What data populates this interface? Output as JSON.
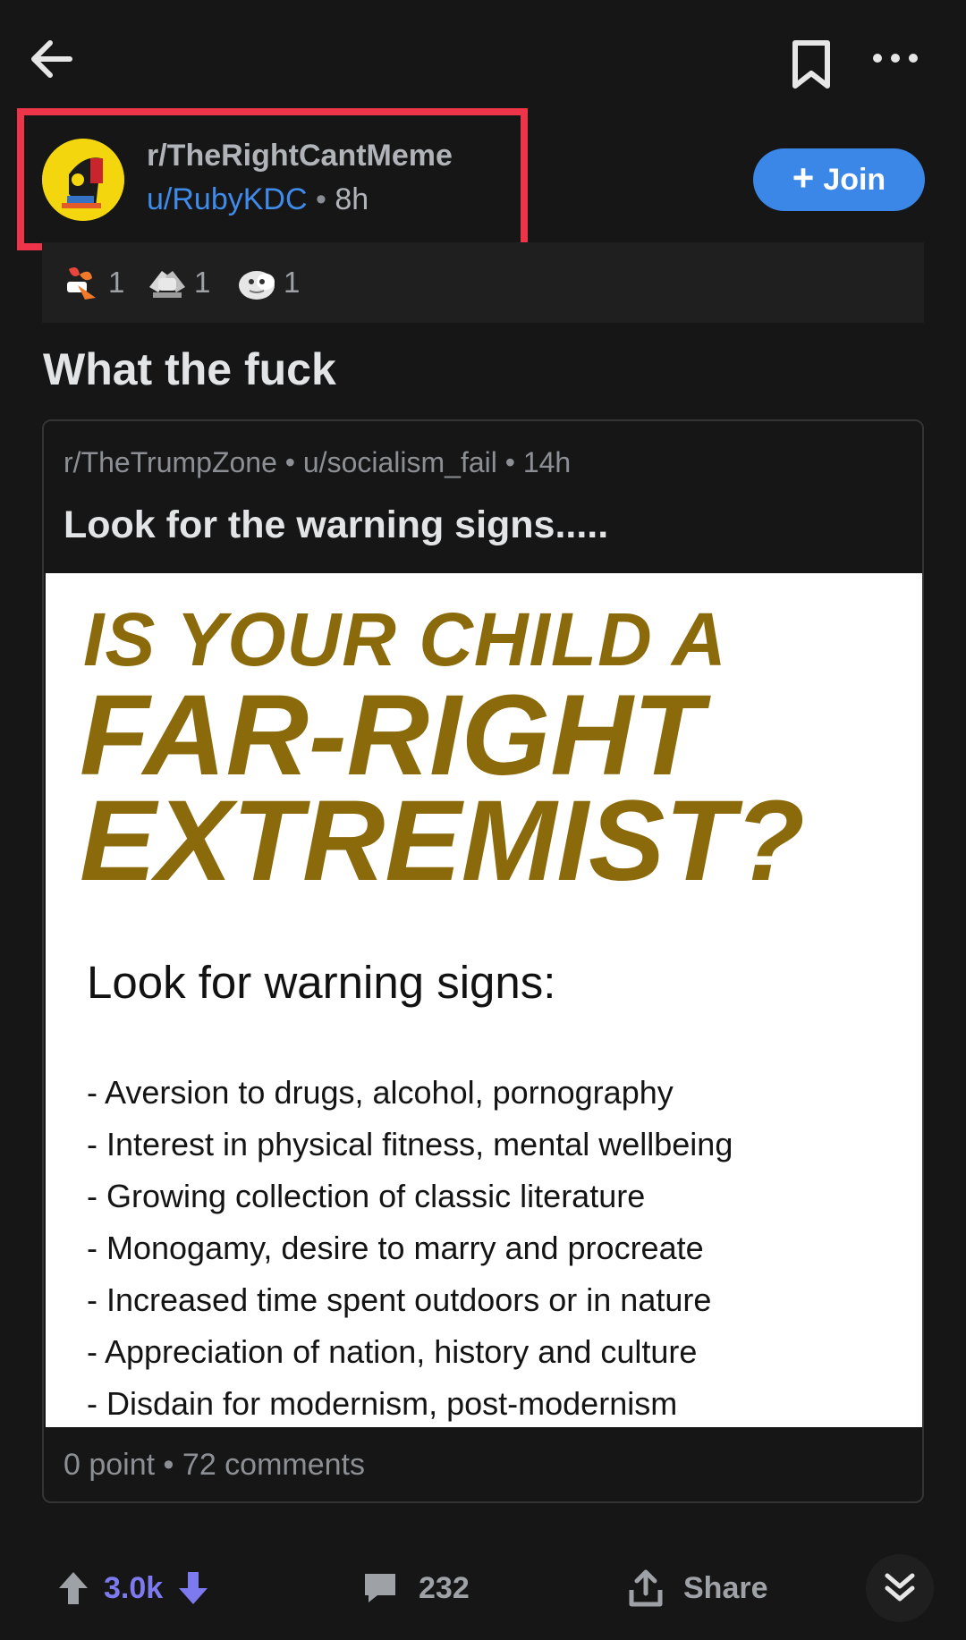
{
  "topbar": {
    "icons": {
      "back": "arrow-left-icon",
      "bookmark": "bookmark-icon",
      "more": "more-horizontal-icon"
    }
  },
  "header": {
    "subreddit": "r/TheRightCantMeme",
    "username": "u/RubyKDC",
    "separator": "•",
    "age": "8h",
    "join_label": "Join",
    "highlight_color": "#ee3448",
    "join_color": "#3b87e8"
  },
  "awards": [
    {
      "icon": "award-1-icon",
      "count": "1"
    },
    {
      "icon": "award-2-icon",
      "count": "1"
    },
    {
      "icon": "award-3-icon",
      "count": "1"
    }
  ],
  "post": {
    "title": "What the fuck"
  },
  "crosspost": {
    "subreddit": "r/TheTrumpZone",
    "username": "u/socialism_fail",
    "age": "14h",
    "separator": "•",
    "title": "Look for the warning signs.....",
    "image": {
      "headline_1": "IS YOUR CHILD A",
      "headline_2": "FAR-RIGHT",
      "headline_3": "EXTREMIST?",
      "subheading": "Look for warning signs:",
      "items": [
        "- Aversion to drugs, alcohol, pornography",
        "- Interest in physical fitness, mental wellbeing",
        "- Growing collection of classic literature",
        "- Monogamy, desire to marry and procreate",
        "- Increased time spent outdoors or in nature",
        "- Appreciation of nation, history and culture",
        "- Disdain for modernism, post-modernism"
      ],
      "headline_color": "#8b6a0b"
    },
    "points": "0 point",
    "comments": "72 comments"
  },
  "bottom_bar": {
    "score": "3.0k",
    "comment_count": "232",
    "share_label": "Share",
    "score_color": "#7d79ee"
  }
}
